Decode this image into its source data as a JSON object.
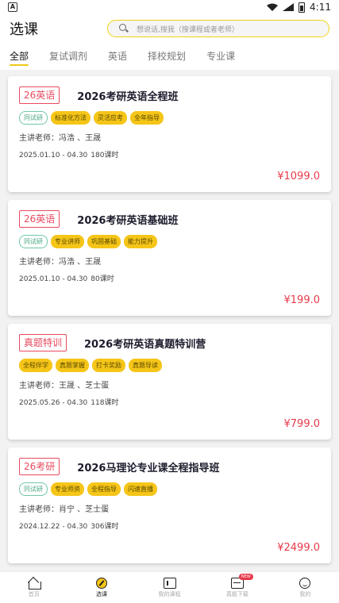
{
  "status": {
    "time": "4:11",
    "left_icon": "A"
  },
  "header": {
    "title": "选课",
    "search_placeholder": "想说话,搜我（搜课程或者老师）"
  },
  "tabs": [
    {
      "label": "全部"
    },
    {
      "label": "复试调剂"
    },
    {
      "label": "英语"
    },
    {
      "label": "择校规划"
    },
    {
      "label": "专业课"
    }
  ],
  "courses": [
    {
      "badge": "26英语",
      "title": "2026考研英语全程班",
      "tags": [
        "同试研",
        "标准化方法",
        "灵活应考",
        "全年指导"
      ],
      "teachers": "主讲老师：冯浩 、王晟",
      "dates": "2025.01.10 - 04.30",
      "hours": "180课时",
      "price": "¥1099.0"
    },
    {
      "badge": "26英语",
      "title": "2026考研英语基础班",
      "tags": [
        "同试研",
        "专业讲师",
        "巩固基础",
        "能力提升"
      ],
      "teachers": "主讲老师：冯浩 、王晟",
      "dates": "2025.01.10 - 04.30",
      "hours": "80课时",
      "price": "¥199.0"
    },
    {
      "badge": "真题特训",
      "title": "2026考研英语真题特训营",
      "tags": [
        "全程伴学",
        "真题掌握",
        "打卡奖励",
        "真题导读"
      ],
      "teachers": "主讲老师：王晟 、芝士蛋",
      "dates": "2025.05.26 - 04.30",
      "hours": "118课时",
      "price": "¥799.0"
    },
    {
      "badge": "26考研",
      "title": "2026马理论专业课全程指导班",
      "tags": [
        "同试研",
        "专业师资",
        "全程指导",
        "闪速直播"
      ],
      "teachers": "主讲老师：肖宁 、芝士蛋",
      "dates": "2024.12.22 - 04.30",
      "hours": "306课时",
      "price": "¥2499.0"
    }
  ],
  "bottom_nav": [
    {
      "label": "首页",
      "icon": "home-icon"
    },
    {
      "label": "选课",
      "icon": "compass-icon"
    },
    {
      "label": "我的课程",
      "icon": "course-icon"
    },
    {
      "label": "真题下载",
      "icon": "download-icon",
      "badge": "NEW"
    },
    {
      "label": "我的",
      "icon": "mine-icon"
    }
  ],
  "colors": {
    "accent": "#f5c518",
    "price": "#e8394a",
    "badge_border": "#e84a5f",
    "outline_tag": "#6fc6a6"
  }
}
